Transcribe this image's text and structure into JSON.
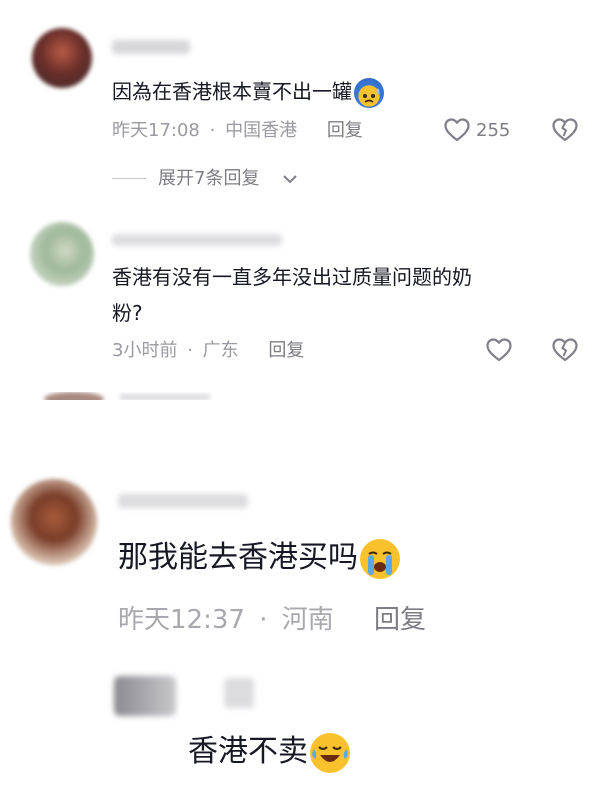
{
  "section_top": {
    "comments": [
      {
        "text": "因為在香港根本賣不出一罐",
        "time": "昨天17:08",
        "location": "中国香港",
        "reply_label": "回复",
        "likes": "255",
        "emoji": "cold-sweat-blue-face",
        "expand_replies_label": "展开7条回复"
      },
      {
        "text_line1": "香港有没有一直多年没出过质量问题的奶",
        "text_line2": "粉?",
        "time": "3小时前",
        "location": "广东",
        "reply_label": "回复"
      }
    ]
  },
  "section_bottom": {
    "comments": [
      {
        "text": "那我能去香港买吗",
        "emoji": "loudly-crying-face",
        "time": "昨天12:37",
        "location": "河南",
        "reply_label": "回复"
      },
      {
        "text": "香港不卖",
        "emoji": "tears-of-joy-face"
      }
    ]
  },
  "separator": "·",
  "colors": {
    "text": "#161823",
    "meta": "#9a9aa2",
    "emoji_yellow": "#f9c12b",
    "emoji_blue": "#3b7ad9"
  }
}
